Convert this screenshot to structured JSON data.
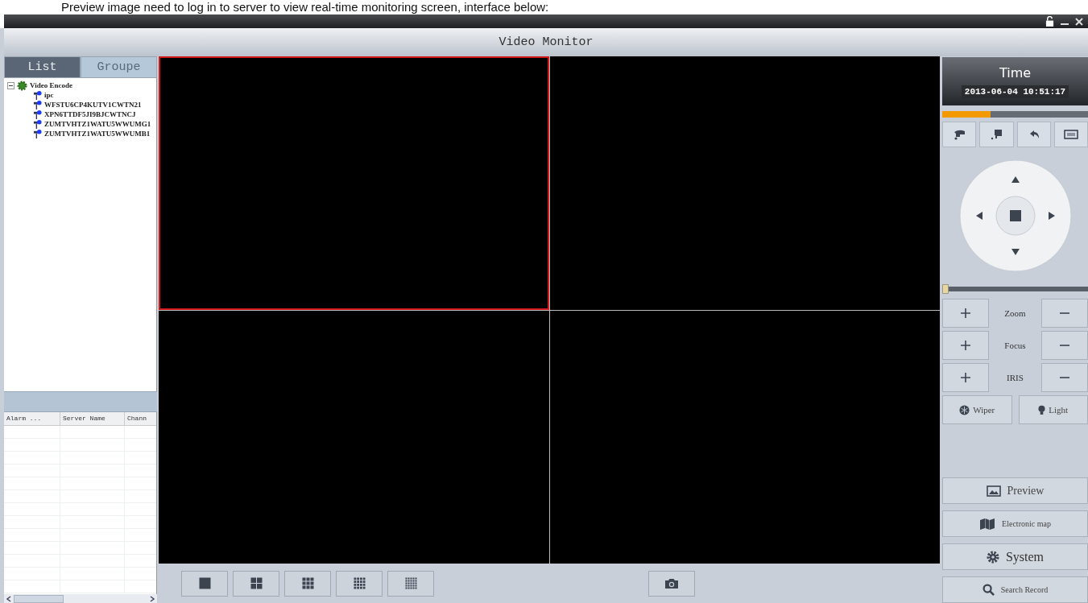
{
  "caption": "Preview image need to log in to server to view real-time monitoring screen, interface below:",
  "window": {
    "title": "Video Monitor"
  },
  "sidebar": {
    "tabs": [
      {
        "label": "List",
        "selected": true
      },
      {
        "label": "Groupe",
        "selected": false
      }
    ],
    "tree": [
      {
        "label": "Video Encode",
        "expanded": true,
        "children": [
          {
            "label": "ipc"
          },
          {
            "label": "WFSTU6CP4KUTV1CWTN21"
          },
          {
            "label": "XPN6TTDF5JI9BJCWTNCJ"
          },
          {
            "label": "ZUMTVHTZ1WATU5WWUMG1"
          },
          {
            "label": "ZUMTVHTZ1WATU5WWUMB1"
          }
        ]
      }
    ]
  },
  "alarm_table": {
    "columns": [
      "Alarm ...",
      "Server Name",
      "Chann"
    ]
  },
  "video_tiles": [
    {
      "selected": true
    },
    {
      "selected": false
    },
    {
      "selected": false
    },
    {
      "selected": false
    }
  ],
  "layout_buttons": [
    {
      "kind": "single"
    },
    {
      "kind": "quad"
    },
    {
      "kind": "nine"
    },
    {
      "kind": "sixteen"
    },
    {
      "kind": "twentyfive"
    }
  ],
  "right_panel": {
    "time_label": "Time",
    "time": "2013-06-04 10:51:17",
    "progress": {
      "level": 0.33
    },
    "speed": {
      "level": 0
    },
    "lens": [
      {
        "label": "Zoom"
      },
      {
        "label": "Focus"
      },
      {
        "label": "IRIS"
      }
    ],
    "toggles": [
      {
        "kind": "wiper",
        "label": "Wiper"
      },
      {
        "kind": "light",
        "label": "Light"
      }
    ],
    "nav": [
      {
        "kind": "preview",
        "label": "Preview"
      },
      {
        "kind": "map",
        "label": "Electronic map"
      },
      {
        "kind": "system",
        "label": "System"
      },
      {
        "kind": "search",
        "label": "Search Record"
      }
    ]
  }
}
